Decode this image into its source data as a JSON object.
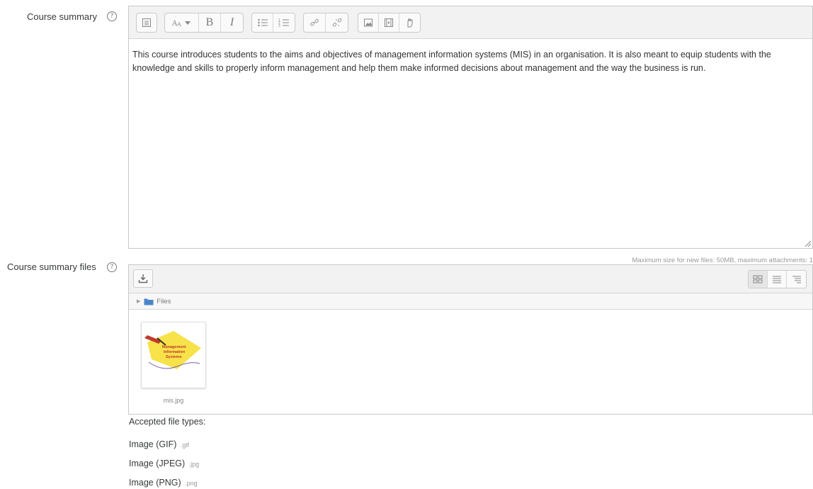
{
  "course_summary": {
    "label": "Course summary",
    "help_icon": "question-circle-icon",
    "toolbar": {
      "groups": [
        [
          "collapse-icon"
        ],
        [
          "text-style-icon",
          "bold-icon",
          "italic-icon"
        ],
        [
          "unordered-list-icon",
          "ordered-list-icon"
        ],
        [
          "link-icon",
          "unlink-icon"
        ],
        [
          "image-icon",
          "media-icon",
          "manage-files-icon"
        ]
      ],
      "bold_glyph": "B",
      "italic_glyph": "I"
    },
    "content": "This course introduces students to the aims and objectives of management information systems (MIS) in an organisation. It is also meant to equip students with the knowledge and skills to properly inform management and help them make informed decisions about management and the way the business is run."
  },
  "course_summary_files": {
    "label": "Course summary files",
    "help_icon": "question-circle-icon",
    "max_info": "Maximum size for new files: 50MB, maximum attachments: 1",
    "path_label": "Files",
    "files": [
      {
        "name": "mis.jpg",
        "thumb_text": [
          "Management",
          "Information",
          "Systems"
        ]
      }
    ]
  },
  "accepted_types": {
    "heading": "Accepted file types:",
    "types": [
      {
        "name": "Image (GIF)",
        "ext": ".gif"
      },
      {
        "name": "Image (JPEG)",
        "ext": ".jpg"
      },
      {
        "name": "Image (PNG)",
        "ext": ".png"
      }
    ]
  },
  "colors": {
    "toolbar_bg": "#f2f2f2",
    "border": "#c8c8c8",
    "thumb_yellow": "#f7e24a",
    "thumb_red": "#c0392b",
    "folder_blue": "#4a86c7"
  }
}
